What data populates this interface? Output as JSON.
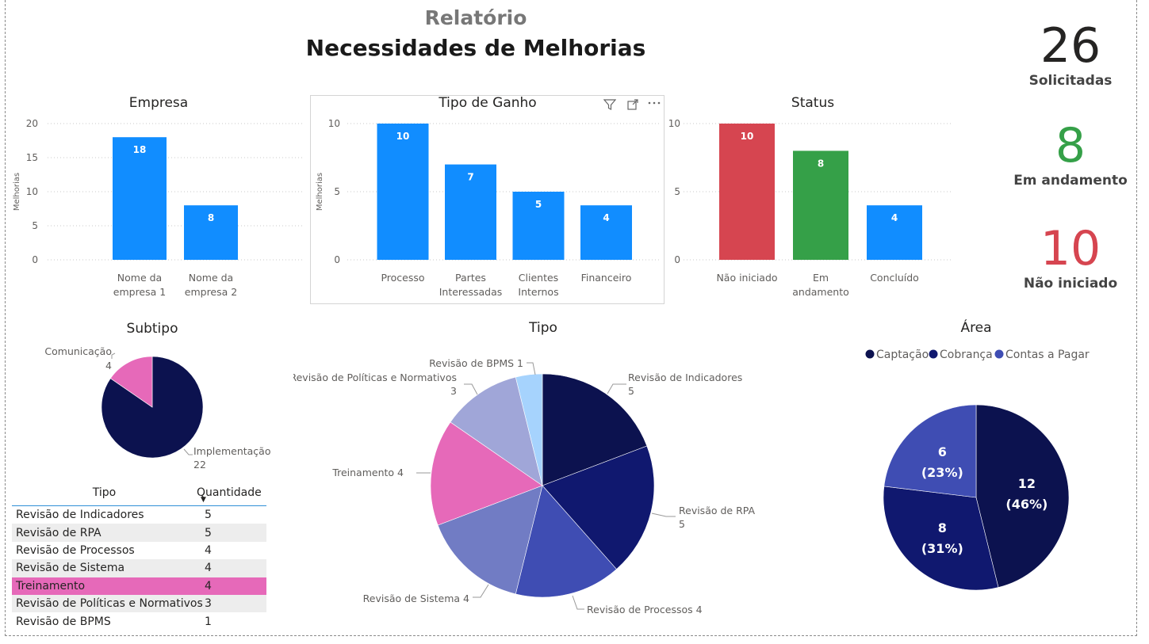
{
  "header": {
    "subtitle": "Relatório",
    "title": "Necessidades de Melhorias"
  },
  "kpis": [
    {
      "value": "26",
      "label": "Solicitadas",
      "color": "#252423"
    },
    {
      "value": "8",
      "label": "Em andamento",
      "color": "#35a048"
    },
    {
      "value": "10",
      "label": "Não iniciado",
      "color": "#d64550"
    }
  ],
  "visual_header_icons": [
    "filter-icon",
    "focus-mode-icon",
    "more-options-icon"
  ],
  "table": {
    "columns": [
      "Tipo",
      "Quantidade"
    ],
    "rows": [
      {
        "tipo": "Revisão de Indicadores",
        "quantidade": "5"
      },
      {
        "tipo": "Revisão de RPA",
        "quantidade": "5"
      },
      {
        "tipo": "Revisão de Processos",
        "quantidade": "4"
      },
      {
        "tipo": "Revisão de Sistema",
        "quantidade": "4"
      },
      {
        "tipo": "Treinamento",
        "quantidade": "4"
      },
      {
        "tipo": "Revisão de Políticas e Normativos",
        "quantidade": "3"
      },
      {
        "tipo": "Revisão de BPMS",
        "quantidade": "1"
      }
    ],
    "highlight_color": "#e669b9"
  },
  "chart_data": [
    {
      "type": "bar",
      "title": "Empresa",
      "ylabel": "Melhorias",
      "categories": [
        [
          "Nome da",
          "empresa 1"
        ],
        [
          "Nome da",
          "empresa 2"
        ]
      ],
      "values": [
        18,
        8
      ],
      "colors": [
        "#118dff",
        "#118dff"
      ],
      "ylim": [
        0,
        20
      ],
      "yticks": [
        0,
        5,
        10,
        15,
        20
      ],
      "grid": true
    },
    {
      "type": "bar",
      "title": "Tipo de Ganho",
      "ylabel": "Melhorias",
      "categories": [
        [
          "Processo"
        ],
        [
          "Partes",
          "Interessadas"
        ],
        [
          "Clientes",
          "Internos"
        ],
        [
          "Financeiro"
        ]
      ],
      "values": [
        10,
        7,
        5,
        4
      ],
      "colors": [
        "#118dff",
        "#118dff",
        "#118dff",
        "#118dff"
      ],
      "ylim": [
        0,
        10
      ],
      "yticks": [
        0,
        5,
        10
      ],
      "grid": true
    },
    {
      "type": "bar",
      "title": "Status",
      "ylabel": "",
      "categories": [
        [
          "Não iniciado"
        ],
        [
          "Em",
          "andamento"
        ],
        [
          "Concluído"
        ]
      ],
      "values": [
        10,
        8,
        4
      ],
      "colors": [
        "#d64550",
        "#35a048",
        "#118dff"
      ],
      "ylim": [
        0,
        10
      ],
      "yticks": [
        0,
        5,
        10
      ],
      "grid": true
    },
    {
      "type": "pie",
      "title": "Subtipo",
      "slices": [
        {
          "label": "Implementação",
          "value": 22,
          "color": "#0c124f"
        },
        {
          "label": "Comunicação",
          "value": 4,
          "color": "#e669b9"
        }
      ]
    },
    {
      "type": "pie",
      "title": "Tipo",
      "slices": [
        {
          "label": "Revisão de Indicadores",
          "value": 5,
          "color": "#0c124f"
        },
        {
          "label": "Revisão de RPA",
          "value": 5,
          "color": "#10186f"
        },
        {
          "label": "Revisão de Processos",
          "value": 4,
          "color": "#3f4db3"
        },
        {
          "label": "Revisão de Sistema",
          "value": 4,
          "color": "#717cc4"
        },
        {
          "label": "Treinamento",
          "value": 4,
          "color": "#e669b9"
        },
        {
          "label": "Revisão de Políticas e Normativos",
          "value": 3,
          "color": "#a0a6d8"
        },
        {
          "label": "Revisão de BPMS",
          "value": 1,
          "color": "#a6d3fd"
        }
      ]
    },
    {
      "type": "pie",
      "title": "Área",
      "legend": "top",
      "slices": [
        {
          "label": "Captação",
          "value": 12,
          "pct": "(46%)",
          "color": "#0c124f"
        },
        {
          "label": "Cobrança",
          "value": 8,
          "pct": "(31%)",
          "color": "#10186f"
        },
        {
          "label": "Contas a Pagar",
          "value": 6,
          "pct": "(23%)",
          "color": "#3f4db3"
        }
      ]
    }
  ]
}
